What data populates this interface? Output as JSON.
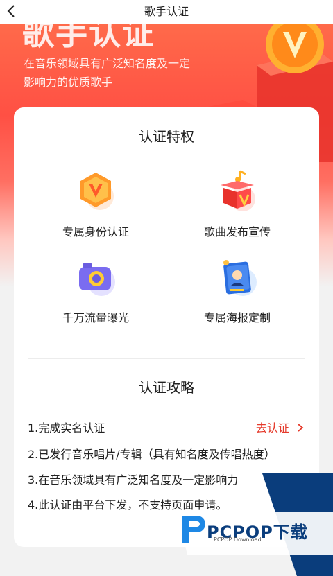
{
  "header": {
    "title": "歌手认证",
    "back_icon": "chevron-left-icon"
  },
  "hero": {
    "big_title": "歌手认证",
    "description": "在音乐领域具有广泛知名度及一定影响力的优质歌手",
    "colors": {
      "start": "#ff6a4a",
      "end": "#ff5044"
    }
  },
  "privileges": {
    "title": "认证特权",
    "items": [
      {
        "label": "专属身份认证",
        "icon": "v-badge-icon"
      },
      {
        "label": "歌曲发布宣传",
        "icon": "gift-box-icon"
      },
      {
        "label": "千万流量曝光",
        "icon": "camera-icon"
      },
      {
        "label": "专属海报定制",
        "icon": "poster-icon"
      }
    ]
  },
  "guide": {
    "title": "认证攻略",
    "steps": [
      "1.完成实名认证",
      "2.已发行音乐唱片/专辑（具有知名度及传唱热度）",
      "3.在音乐领域具有广泛知名度及一定影响力",
      "4.此认证由平台下发，不支持页面申请。"
    ],
    "action_label": "去认证",
    "action_icon": "chevron-right-icon",
    "accent": "#e53b2c"
  },
  "watermark": {
    "brand": "PCPOP下载",
    "sub": "PCPOP Download"
  }
}
